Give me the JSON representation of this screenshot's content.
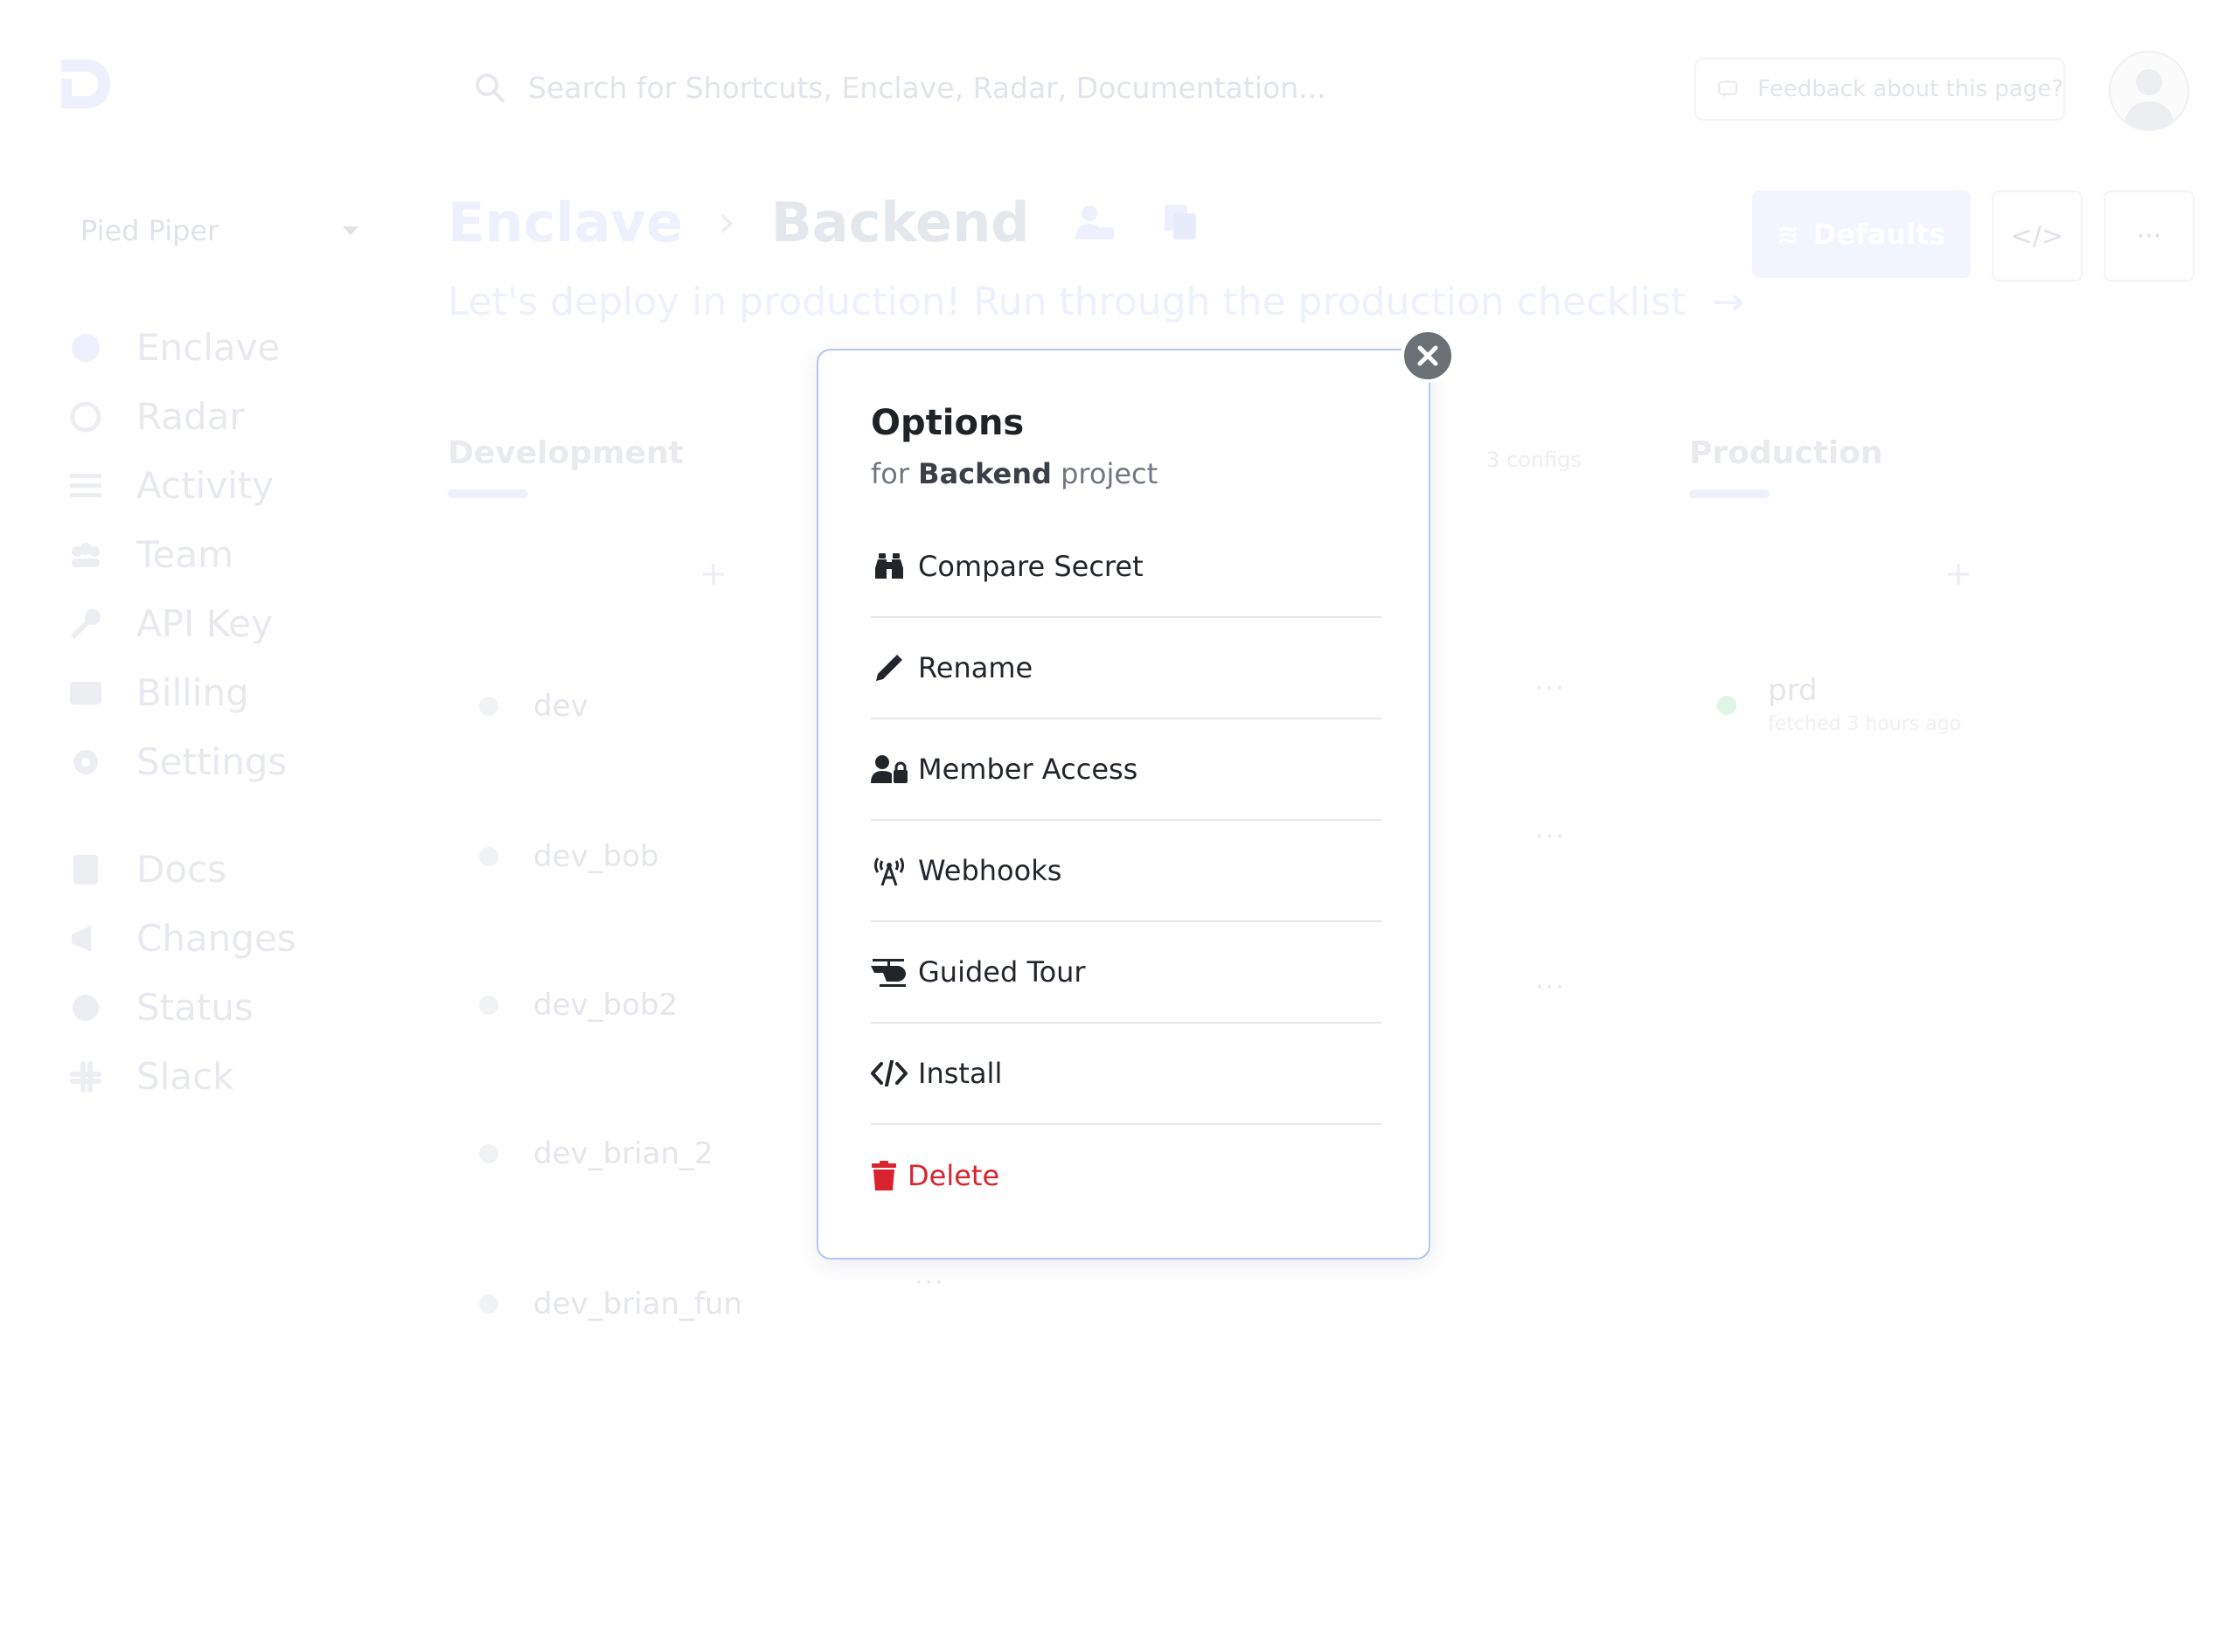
{
  "search": {
    "placeholder": "Search for Shortcuts, Enclave, Radar, Documentation..."
  },
  "feedback": {
    "label": "Feedback about this page?"
  },
  "workspace": {
    "name": "Pied Piper"
  },
  "sidebar": {
    "items": [
      {
        "label": "Enclave",
        "icon": "cube-icon"
      },
      {
        "label": "Radar",
        "icon": "radar-icon"
      },
      {
        "label": "Activity",
        "icon": "list-icon"
      },
      {
        "label": "Team",
        "icon": "team-icon"
      },
      {
        "label": "API Key",
        "icon": "key-icon"
      },
      {
        "label": "Billing",
        "icon": "card-icon"
      },
      {
        "label": "Settings",
        "icon": "gear-icon"
      }
    ],
    "secondary": [
      {
        "label": "Docs",
        "icon": "book-icon"
      },
      {
        "label": "Changes",
        "icon": "megaphone-icon"
      },
      {
        "label": "Status",
        "icon": "status-icon"
      },
      {
        "label": "Slack",
        "icon": "slack-icon"
      }
    ]
  },
  "header": {
    "crumb_root": "Enclave",
    "crumb_sep": "›",
    "crumb_project": "Backend",
    "subtitle": "Let's deploy in production! Run through the production checklist",
    "subtitle_arrow": "→",
    "defaults_label": "Defaults",
    "code_label": "</>",
    "more_label": "···"
  },
  "columns": {
    "development": "Development",
    "production": "Production",
    "configs_count": "3 configs",
    "plus": "+",
    "dev_configs": [
      "dev",
      "dev_bob",
      "dev_bob2",
      "dev_brian_2",
      "dev_brian_fun"
    ],
    "row_menu": "···",
    "prd_name": "prd",
    "prd_fetched": "fetched 3 hours ago"
  },
  "modal": {
    "title": "Options",
    "subtitle_prefix": "for",
    "project": "Backend",
    "subtitle_suffix": "project",
    "items": [
      {
        "label": "Compare Secret",
        "icon": "binoculars-icon"
      },
      {
        "label": "Rename",
        "icon": "pencil-icon"
      },
      {
        "label": "Member Access",
        "icon": "user-lock-icon"
      },
      {
        "label": "Webhooks",
        "icon": "broadcast-tower-icon"
      },
      {
        "label": "Guided Tour",
        "icon": "helicopter-icon"
      },
      {
        "label": "Install",
        "icon": "code-icon"
      },
      {
        "label": "Delete",
        "icon": "trash-icon"
      }
    ]
  },
  "colors": {
    "accent": "#b9c4f3",
    "danger": "#d9232e",
    "close": "#6b7075"
  }
}
